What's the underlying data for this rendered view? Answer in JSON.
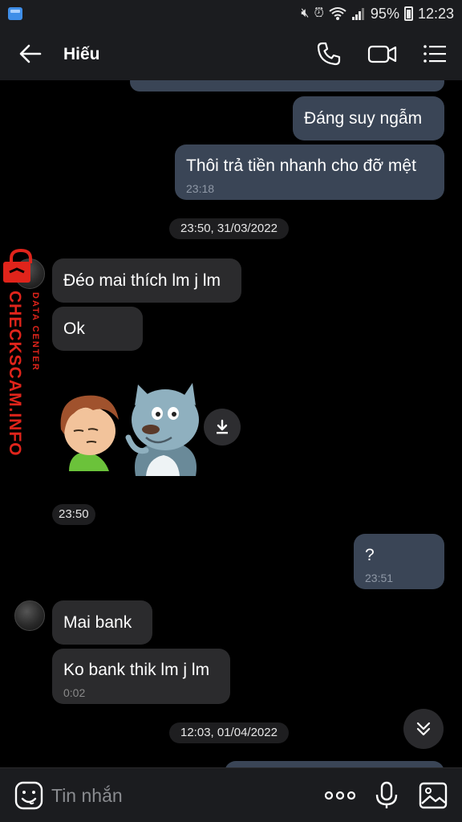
{
  "status_bar": {
    "battery": "95%",
    "time": "12:23"
  },
  "header": {
    "title": "Hiếu",
    "icons": [
      "back-arrow-icon",
      "phone-icon",
      "video-call-icon",
      "menu-list-icon"
    ]
  },
  "messages": [
    {
      "side": "out",
      "text": "Đáng suy ngẫm"
    },
    {
      "side": "out",
      "text": "Thôi trả tiền nhanh cho đỡ mệt",
      "time": "23:18"
    },
    {
      "type": "date",
      "text": "23:50, 31/03/2022"
    },
    {
      "side": "in",
      "text": "Đéo mai thích lm j lm"
    },
    {
      "side": "in",
      "text": "Ok"
    },
    {
      "type": "sticker",
      "icon": "sticker-boy-and-wolf"
    },
    {
      "type": "time",
      "text": "23:50"
    },
    {
      "side": "out",
      "text": "?",
      "time": "23:51"
    },
    {
      "side": "in",
      "text": "Mai bank"
    },
    {
      "side": "in",
      "text": "Ko bank thik lm j lm",
      "time": "0:02"
    },
    {
      "type": "date",
      "text": "12:03, 01/04/2022"
    }
  ],
  "watermark": {
    "main": "CHECKSCAM.INFO",
    "sub": "DATA CENTER"
  },
  "input": {
    "placeholder": "Tin nhắn"
  },
  "colors": {
    "outgoing_bubble": "#3a4556",
    "incoming_bubble": "#2b2b2d",
    "watermark": "#e0241b"
  }
}
